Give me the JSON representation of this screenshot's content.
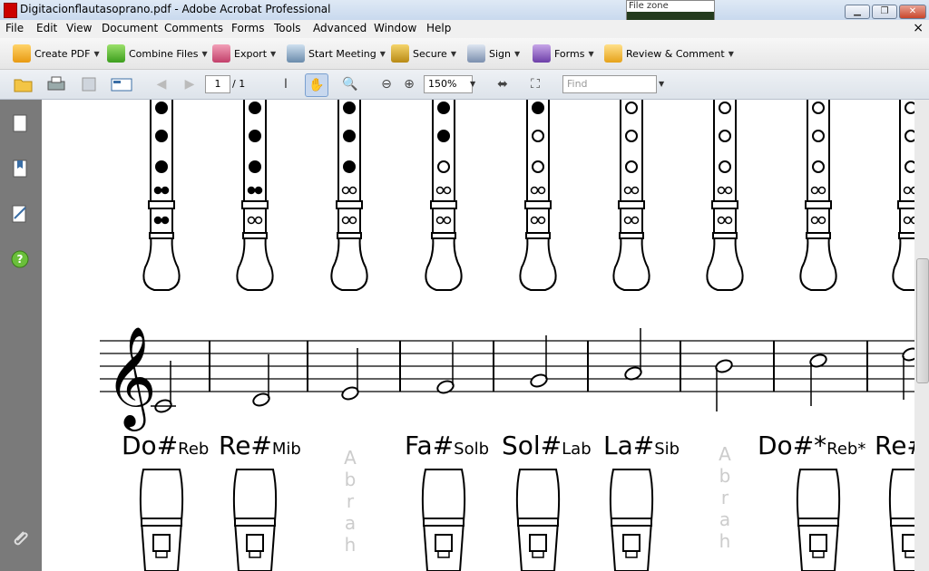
{
  "window": {
    "title": "Digitacionflautasoprano.pdf - Adobe Acrobat Professional",
    "file_zone_label": "File zone"
  },
  "menubar": {
    "items": [
      "File",
      "Edit",
      "View",
      "Document",
      "Comments",
      "Forms",
      "Tools",
      "Advanced",
      "Window",
      "Help"
    ]
  },
  "toolbar": {
    "create_pdf": "Create PDF",
    "combine_files": "Combine Files",
    "export": "Export",
    "start_meeting": "Start Meeting",
    "secure": "Secure",
    "sign": "Sign",
    "forms": "Forms",
    "review_comment": "Review & Comment"
  },
  "nav": {
    "page_current": "1",
    "page_total": "/ 1",
    "zoom": "150%",
    "find_placeholder": "Find"
  },
  "sheet": {
    "sharp_labels": [
      {
        "main": "Do#",
        "sub": "Reb"
      },
      {
        "main": "Re#",
        "sub": "Mib"
      },
      {
        "main": "Fa#",
        "sub": "Solb"
      },
      {
        "main": "Sol#",
        "sub": "Lab"
      },
      {
        "main": "La#",
        "sub": "Sib"
      },
      {
        "main": "Do#*",
        "sub": "Reb*"
      },
      {
        "main": "Re#",
        "sub": ""
      }
    ],
    "watermark": "Abrah"
  }
}
